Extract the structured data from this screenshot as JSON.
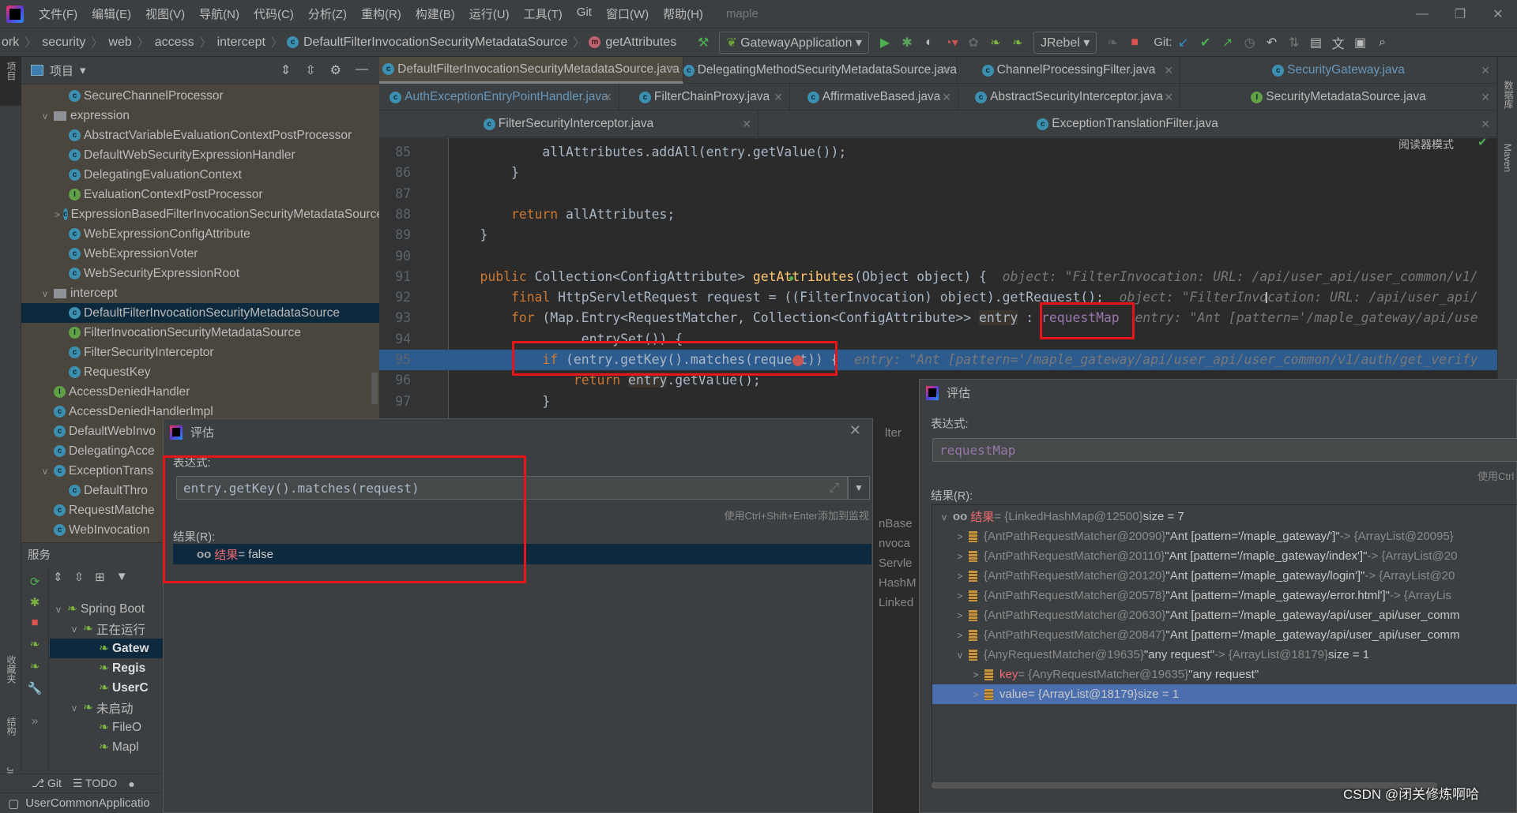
{
  "menu": {
    "items": [
      "文件(F)",
      "编辑(E)",
      "视图(V)",
      "导航(N)",
      "代码(C)",
      "分析(Z)",
      "重构(R)",
      "构建(B)",
      "运行(U)",
      "工具(T)",
      "Git",
      "窗口(W)",
      "帮助(H)"
    ],
    "project": "maple"
  },
  "breadcrumb": [
    "ork",
    "security",
    "web",
    "access",
    "intercept",
    "DefaultFilterInvocationSecurityMetadataSource",
    "getAttributes"
  ],
  "toolbar": {
    "run_config": "GatewayApplication",
    "jrebel": "JRebel",
    "git_label": "Git:"
  },
  "project_panel": {
    "title": "项目",
    "items": [
      {
        "label": "SecureChannelProcessor",
        "indent": 2,
        "icon": "c"
      },
      {
        "label": "expression",
        "indent": 1,
        "icon": "folder",
        "arrow": "v"
      },
      {
        "label": "AbstractVariableEvaluationContextPostProcessor",
        "indent": 2,
        "icon": "c"
      },
      {
        "label": "DefaultWebSecurityExpressionHandler",
        "indent": 2,
        "icon": "c"
      },
      {
        "label": "DelegatingEvaluationContext",
        "indent": 2,
        "icon": "c"
      },
      {
        "label": "EvaluationContextPostProcessor",
        "indent": 2,
        "icon": "i"
      },
      {
        "label": "ExpressionBasedFilterInvocationSecurityMetadataSource",
        "indent": 2,
        "icon": "c",
        "arrow": ">"
      },
      {
        "label": "WebExpressionConfigAttribute",
        "indent": 2,
        "icon": "c"
      },
      {
        "label": "WebExpressionVoter",
        "indent": 2,
        "icon": "c"
      },
      {
        "label": "WebSecurityExpressionRoot",
        "indent": 2,
        "icon": "c"
      },
      {
        "label": "intercept",
        "indent": 1,
        "icon": "folder",
        "arrow": "v"
      },
      {
        "label": "DefaultFilterInvocationSecurityMetadataSource",
        "indent": 2,
        "icon": "c",
        "selected": true
      },
      {
        "label": "FilterInvocationSecurityMetadataSource",
        "indent": 2,
        "icon": "i"
      },
      {
        "label": "FilterSecurityInterceptor",
        "indent": 2,
        "icon": "c"
      },
      {
        "label": "RequestKey",
        "indent": 2,
        "icon": "c"
      },
      {
        "label": "AccessDeniedHandler",
        "indent": 1,
        "icon": "i"
      },
      {
        "label": "AccessDeniedHandlerImpl",
        "indent": 1,
        "icon": "c"
      },
      {
        "label": "DefaultWebInvo",
        "indent": 1,
        "icon": "c"
      },
      {
        "label": "DelegatingAcce",
        "indent": 1,
        "icon": "c"
      },
      {
        "label": "ExceptionTrans",
        "indent": 1,
        "icon": "c",
        "arrow": "v"
      },
      {
        "label": "DefaultThro",
        "indent": 2,
        "icon": "c"
      },
      {
        "label": "RequestMatche",
        "indent": 1,
        "icon": "c"
      },
      {
        "label": "WebInvocation",
        "indent": 1,
        "icon": "c"
      }
    ]
  },
  "services": {
    "title": "服务",
    "items": [
      {
        "label": "Spring Boot",
        "indent": 0,
        "arrow": "v"
      },
      {
        "label": "正在运行",
        "indent": 1,
        "arrow": "v"
      },
      {
        "label": "Gatew",
        "indent": 2,
        "selected": true,
        "bold": true
      },
      {
        "label": "Regis",
        "indent": 2,
        "bold": true
      },
      {
        "label": "UserC",
        "indent": 2,
        "bold": true
      },
      {
        "label": "未启动",
        "indent": 1,
        "arrow": "v"
      },
      {
        "label": "FileO",
        "indent": 2
      },
      {
        "label": "Mapl",
        "indent": 2
      }
    ]
  },
  "left_strip": {
    "project": "项目",
    "bookmarks": "收藏夹",
    "structure": "结构",
    "jrebel": "JRebel"
  },
  "right_strip": {
    "database": "数据库",
    "maven": "Maven"
  },
  "bottom_tabs": {
    "git": "Git",
    "todo": "TODO"
  },
  "status": {
    "text": "UserCommonApplicatio"
  },
  "editor_tabs": [
    [
      {
        "label": "DefaultFilterInvocationSecurityMetadataSource.java",
        "active": true
      },
      {
        "label": "DelegatingMethodSecurityMetadataSource.java"
      },
      {
        "label": "ChannelProcessingFilter.java"
      },
      {
        "label": "SecurityGateway.java",
        "blue": true
      }
    ],
    [
      {
        "label": "AuthExceptionEntryPointHandler.java",
        "blue": true
      },
      {
        "label": "FilterChainProxy.java"
      },
      {
        "label": "AffirmativeBased.java"
      },
      {
        "label": "AbstractSecurityInterceptor.java"
      },
      {
        "label": "SecurityMetadataSource.java",
        "icon": "i"
      }
    ],
    [
      {
        "label": "FilterSecurityInterceptor.java"
      },
      {
        "label": "ExceptionTranslationFilter.java"
      }
    ]
  ],
  "reader_mode": "阅读器模式",
  "code": [
    {
      "n": "85",
      "t": [
        [
          "            allAttributes.addAll(entry.getValue());",
          ""
        ]
      ]
    },
    {
      "n": "86",
      "t": [
        [
          "        }",
          ""
        ]
      ]
    },
    {
      "n": "87",
      "t": []
    },
    {
      "n": "88",
      "t": [
        [
          "        ",
          ""
        ],
        [
          "return",
          "kw"
        ],
        [
          " allAttributes;",
          ""
        ]
      ]
    },
    {
      "n": "89",
      "t": [
        [
          "    }",
          ""
        ]
      ]
    },
    {
      "n": "90",
      "t": []
    },
    {
      "n": "91",
      "t": [
        [
          "    ",
          ""
        ],
        [
          "public",
          "kw"
        ],
        [
          " Collection<ConfigAttribute> ",
          ""
        ],
        [
          "getAttributes",
          "fn"
        ],
        [
          "(Object object) {  ",
          ""
        ],
        [
          "object: \"FilterInvocation: URL: /api/user_api/user_common/v1/",
          "hint"
        ]
      ]
    },
    {
      "n": "92",
      "t": [
        [
          "        ",
          ""
        ],
        [
          "final",
          "kw"
        ],
        [
          " HttpServletRequest request = ((FilterInvocation) object).getRequest();  ",
          ""
        ],
        [
          "object: \"FilterInvocation: URL: /api/user_api/",
          "hint"
        ]
      ]
    },
    {
      "n": "93",
      "t": [
        [
          "        ",
          ""
        ],
        [
          "for",
          "kw"
        ],
        [
          " (Map.Entry<RequestMatcher, Collection<ConfigAttribute>> ",
          ""
        ],
        [
          "entry",
          "var"
        ],
        [
          " : ",
          ""
        ],
        [
          "requestMap",
          "fld"
        ],
        [
          "  ",
          ""
        ],
        [
          "entry: \"Ant [pattern='/maple_gateway/api/use",
          "hint"
        ]
      ]
    },
    {
      "n": "94",
      "t": [
        [
          "                .entrySet()) {",
          ""
        ]
      ]
    },
    {
      "n": "95",
      "t": [
        [
          "            ",
          ""
        ],
        [
          "if",
          "kw"
        ],
        [
          " (entry.getKey().matches(request)) {  ",
          ""
        ],
        [
          "entry: \"Ant [pattern='/maple_gateway/api/user_api/user_common/v1/auth/get_verify",
          "hint"
        ]
      ],
      "hl": true
    },
    {
      "n": "96",
      "t": [
        [
          "                ",
          ""
        ],
        [
          "return",
          "kw"
        ],
        [
          " ",
          ""
        ],
        [
          "entry",
          "var"
        ],
        [
          ".getValue();",
          ""
        ]
      ]
    },
    {
      "n": "97",
      "t": [
        [
          "            }",
          ""
        ]
      ]
    }
  ],
  "eval_left": {
    "title": "评估",
    "expr_label": "表达式:",
    "expression": "entry.getKey().matches(request)",
    "hint": "使用Ctrl+Shift+Enter添加到监视",
    "result_label": "结果(R):",
    "result_name": "结果",
    "result_value": " = false"
  },
  "eval_right": {
    "title": "评估",
    "expr_label": "表达式:",
    "expression": "requestMap",
    "hint": "使用Ctrl",
    "result_label": "结果(R):",
    "rows": [
      {
        "level": 0,
        "arrow": "v",
        "oo": true,
        "name": "结果",
        "id": " = {LinkedHashMap@12500}",
        "val": "  size = 7",
        "tail": ""
      },
      {
        "level": 1,
        "arrow": ">",
        "id": "{AntPathRequestMatcher@20090}",
        "val": " \"Ant [pattern='/maple_gateway/']\"",
        "tail": " -> {ArrayList@20095}"
      },
      {
        "level": 1,
        "arrow": ">",
        "id": "{AntPathRequestMatcher@20110}",
        "val": " \"Ant [pattern='/maple_gateway/index']\"",
        "tail": " -> {ArrayList@20"
      },
      {
        "level": 1,
        "arrow": ">",
        "id": "{AntPathRequestMatcher@20120}",
        "val": " \"Ant [pattern='/maple_gateway/login']\"",
        "tail": " -> {ArrayList@20"
      },
      {
        "level": 1,
        "arrow": ">",
        "id": "{AntPathRequestMatcher@20578}",
        "val": " \"Ant [pattern='/maple_gateway/error.html']\"",
        "tail": " -> {ArrayLis"
      },
      {
        "level": 1,
        "arrow": ">",
        "id": "{AntPathRequestMatcher@20630}",
        "val": " \"Ant [pattern='/maple_gateway/api/user_api/user_comm",
        "tail": ""
      },
      {
        "level": 1,
        "arrow": ">",
        "id": "{AntPathRequestMatcher@20847}",
        "val": " \"Ant [pattern='/maple_gateway/api/user_api/user_comm",
        "tail": ""
      },
      {
        "level": 1,
        "arrow": "v",
        "id": "{AnyRequestMatcher@19635}",
        "val": " \"any request\"",
        "tail": " -> {ArrayList@18179}",
        "extra": "  size = 1"
      },
      {
        "level": 2,
        "arrow": ">",
        "name": "key",
        "id": " = {AnyRequestMatcher@19635}",
        "val": " \"any request\"",
        "tail": ""
      },
      {
        "level": 2,
        "arrow": ">",
        "name2": "value",
        "id": " = {ArrayList@18179}",
        "val": "  size = 1",
        "tail": "",
        "selected": true
      }
    ]
  },
  "behind_text": [
    "lter",
    "nBase",
    "nvoca",
    "Servle",
    "HashM",
    "Linked"
  ],
  "watermark": "CSDN @闭关修炼啊哈"
}
